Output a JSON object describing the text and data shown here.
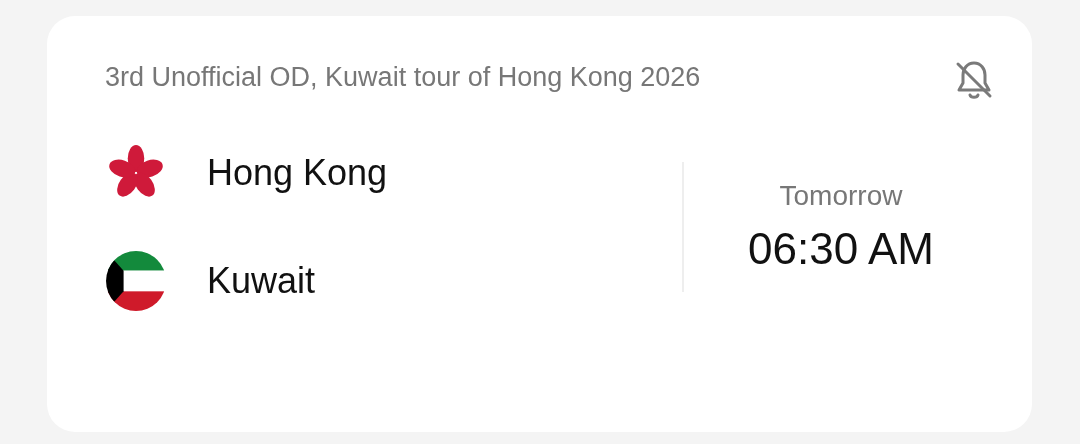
{
  "match": {
    "title": "3rd Unofficial OD, Kuwait tour of Hong Kong 2026",
    "notifications_on": false
  },
  "teams": [
    {
      "name": "Hong Kong",
      "kind": "flower"
    },
    {
      "name": "Kuwait",
      "kind": "tricolor"
    }
  ],
  "schedule": {
    "day": "Tomorrow",
    "time": "06:30 AM"
  }
}
